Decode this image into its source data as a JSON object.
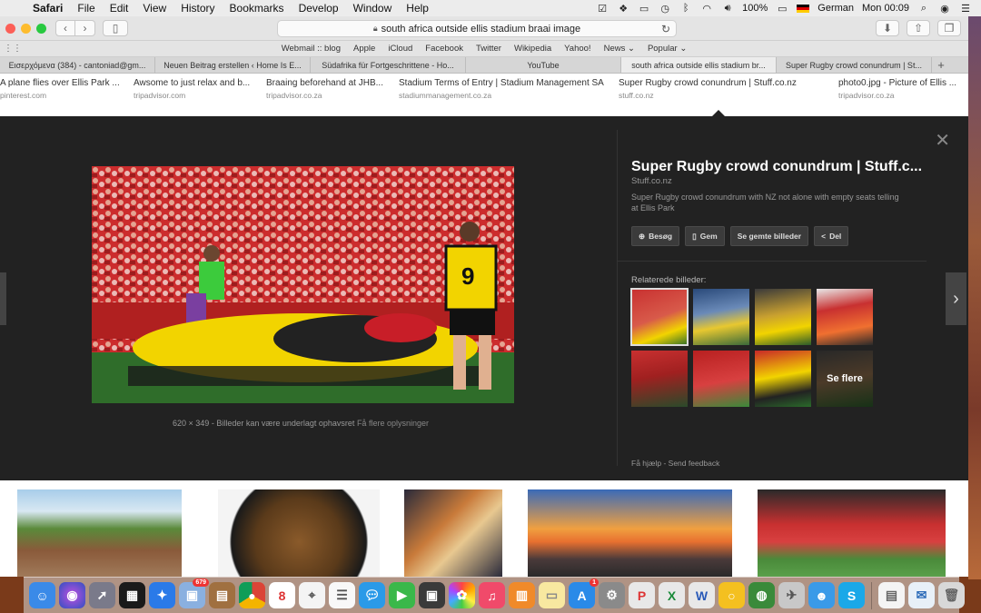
{
  "menubar": {
    "app_name": "Safari",
    "items": [
      "File",
      "Edit",
      "View",
      "History",
      "Bookmarks",
      "Develop",
      "Window",
      "Help"
    ],
    "battery": "100%",
    "input_language": "German",
    "clock": "Mon 00:09"
  },
  "toolbar": {
    "url": "south africa outside ellis stadium braai image"
  },
  "favorites": [
    "Webmail :: blog",
    "Apple",
    "iCloud",
    "Facebook",
    "Twitter",
    "Wikipedia",
    "Yahoo!",
    "News ⌄",
    "Popular ⌄"
  ],
  "tabs": [
    "Εισερχόμενα (384) - cantoniad@gm...",
    "Neuen Beitrag erstellen ‹ Home Is E...",
    "Südafrika für Fortgeschrittene - Ho...",
    "YouTube",
    "south africa outside ellis stadium br...",
    "Super Rugby crowd conundrum | St..."
  ],
  "active_tab_index": 4,
  "results_row": [
    {
      "title": "A plane flies over Ellis Park ...",
      "site": "pinterest.com"
    },
    {
      "title": "Awsome to just relax and b...",
      "site": "tripadvisor.com"
    },
    {
      "title": "Braaing beforehand at JHB...",
      "site": "tripadvisor.co.za"
    },
    {
      "title": "Stadium Terms of Entry | Stadium Management SA",
      "site": "stadiummanagement.co.za"
    },
    {
      "title": "Super Rugby crowd conundrum | Stuff.co.nz",
      "site": "stuff.co.nz"
    },
    {
      "title": "photo0.jpg - Picture of Ellis ...",
      "site": "tripadvisor.co.za"
    }
  ],
  "preview": {
    "title": "Super Rugby crowd conundrum | Stuff.c...",
    "site": "Stuff.co.nz",
    "description": "Super Rugby crowd conundrum with NZ not alone with empty seats telling at Ellis Park",
    "dimensions": "620 × 349",
    "separator": "-",
    "copyright_note": "Billeder kan være underlagt ophavsret",
    "more_info": "Få flere oplysninger",
    "actions": [
      {
        "label": "Besøg",
        "icon": "globe-icon"
      },
      {
        "label": "Gem",
        "icon": "bookmark-icon"
      },
      {
        "label": "Se gemte billeder",
        "icon": ""
      },
      {
        "label": "Del",
        "icon": "share-icon"
      }
    ],
    "related_label": "Relaterede billeder:",
    "see_more": "Se flere",
    "help": "Få hjælp",
    "feedback": "Send feedback"
  },
  "dock": {
    "photos_badge": "679",
    "calendar_day": "8",
    "appstore_badge": "1"
  },
  "colors": {
    "preview_bg": "#222222",
    "jersey_yellow": "#f2d400",
    "stadium_red": "#c8282a"
  }
}
